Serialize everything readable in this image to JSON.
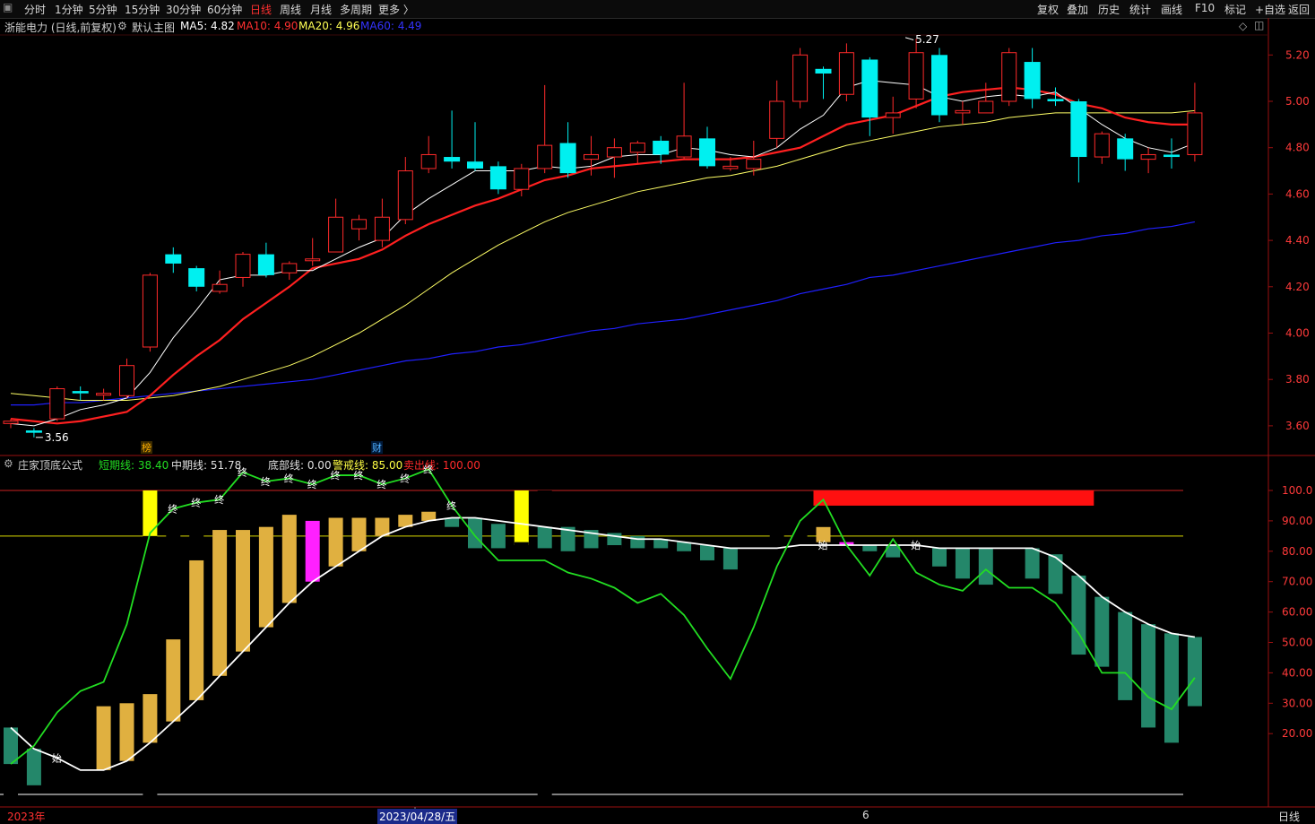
{
  "toolbar": {
    "left": [
      "分时",
      "1分钟",
      "5分钟",
      "15分钟",
      "30分钟",
      "60分钟",
      "日线",
      "周线",
      "月线",
      "多周期",
      "更多 〉"
    ],
    "active": "日线",
    "right": [
      "复权",
      "叠加",
      "历史",
      "统计",
      "画线",
      "F10",
      "标记",
      "+自选",
      "返回"
    ]
  },
  "main_header": {
    "title": "浙能电力 (日线,前复权)",
    "template": "默认主图",
    "ma5": "MA5: 4.82",
    "ma10": "MA10: 4.90",
    "ma20": "MA20: 4.96",
    "ma60": "MA60: 4.49"
  },
  "indicator_header": {
    "name": "庄家顶底公式",
    "short": "短期线: 38.40",
    "mid": "中期线: 51.78",
    "bottom": "底部线: 0.00",
    "warn": "警戒线: 85.00",
    "sell": "卖出线: 100.00"
  },
  "bottom": {
    "year": "2023年",
    "date": "2023/04/28/五",
    "month": "6",
    "period": "日线"
  },
  "colors": {
    "up": "#ff2a2a",
    "down": "#00f0f0",
    "ma5": "#ffffff",
    "ma10": "#ff2020",
    "ma20": "#ffff66",
    "ma60": "#2020ff",
    "short": "#22dd22",
    "mid": "#ffffff",
    "gold": "#e0b040",
    "teal": "#24876a",
    "magenta": "#ff20ff",
    "yellow": "#ffff00"
  },
  "chart_data": {
    "type": "candlestick",
    "price_axis": {
      "ticks": [
        "5.20",
        "5.00",
        "4.80",
        "4.60",
        "4.40",
        "4.20",
        "4.00",
        "3.80",
        "3.60"
      ]
    },
    "marks": {
      "high": "5.27",
      "low": "3.56",
      "bang": "榜",
      "cai": "财"
    },
    "candles": [
      [
        3.61,
        3.62,
        3.59,
        3.63
      ],
      [
        3.58,
        3.57,
        3.55,
        3.59
      ],
      [
        3.63,
        3.76,
        3.62,
        3.77
      ],
      [
        3.75,
        3.74,
        3.71,
        3.77
      ],
      [
        3.74,
        3.74,
        3.71,
        3.76
      ],
      [
        3.73,
        3.86,
        3.72,
        3.89
      ],
      [
        3.94,
        4.25,
        3.92,
        4.26
      ],
      [
        4.34,
        4.3,
        4.26,
        4.37
      ],
      [
        4.28,
        4.2,
        4.18,
        4.29
      ],
      [
        4.18,
        4.21,
        4.17,
        4.27
      ],
      [
        4.24,
        4.34,
        4.2,
        4.35
      ],
      [
        4.34,
        4.25,
        4.24,
        4.39
      ],
      [
        4.26,
        4.3,
        4.23,
        4.31
      ],
      [
        4.32,
        4.32,
        4.29,
        4.41
      ],
      [
        4.35,
        4.5,
        4.35,
        4.58
      ],
      [
        4.45,
        4.49,
        4.4,
        4.51
      ],
      [
        4.4,
        4.5,
        4.37,
        4.58
      ],
      [
        4.49,
        4.7,
        4.47,
        4.76
      ],
      [
        4.71,
        4.77,
        4.69,
        4.85
      ],
      [
        4.76,
        4.74,
        4.71,
        4.96
      ],
      [
        4.74,
        4.71,
        4.7,
        4.91
      ],
      [
        4.72,
        4.62,
        4.6,
        4.74
      ],
      [
        4.62,
        4.71,
        4.59,
        4.73
      ],
      [
        4.71,
        4.81,
        4.69,
        5.07
      ],
      [
        4.82,
        4.69,
        4.67,
        4.91
      ],
      [
        4.75,
        4.77,
        4.68,
        4.85
      ],
      [
        4.76,
        4.8,
        4.67,
        4.84
      ],
      [
        4.78,
        4.82,
        4.73,
        4.83
      ],
      [
        4.83,
        4.77,
        4.73,
        4.85
      ],
      [
        4.76,
        4.85,
        4.75,
        5.08
      ],
      [
        4.84,
        4.72,
        4.71,
        4.89
      ],
      [
        4.71,
        4.72,
        4.7,
        4.76
      ],
      [
        4.71,
        4.75,
        4.68,
        4.83
      ],
      [
        4.84,
        5.0,
        4.8,
        5.09
      ],
      [
        5.0,
        5.2,
        4.97,
        5.23
      ],
      [
        5.14,
        5.12,
        5.01,
        5.15
      ],
      [
        5.03,
        5.21,
        5.0,
        5.25
      ],
      [
        5.18,
        4.93,
        4.85,
        5.19
      ],
      [
        4.93,
        4.95,
        4.86,
        5.02
      ],
      [
        5.01,
        5.21,
        4.97,
        5.27
      ],
      [
        5.2,
        4.94,
        4.91,
        5.23
      ],
      [
        4.95,
        4.96,
        4.9,
        5.0
      ],
      [
        4.95,
        5.0,
        4.96,
        5.08
      ],
      [
        5.0,
        5.21,
        4.98,
        5.23
      ],
      [
        5.17,
        5.01,
        4.97,
        5.23
      ],
      [
        5.01,
        5.0,
        4.98,
        5.06
      ],
      [
        5.0,
        4.76,
        4.65,
        5.01
      ],
      [
        4.76,
        4.86,
        4.73,
        4.87
      ],
      [
        4.84,
        4.75,
        4.7,
        4.86
      ],
      [
        4.75,
        4.77,
        4.69,
        4.8
      ],
      [
        4.77,
        4.76,
        4.71,
        4.84
      ],
      [
        4.77,
        4.95,
        4.74,
        5.08
      ]
    ],
    "ma5": [
      3.61,
      3.6,
      3.63,
      3.67,
      3.69,
      3.72,
      3.83,
      3.98,
      4.1,
      4.23,
      4.25,
      4.25,
      4.27,
      4.27,
      4.32,
      4.37,
      4.41,
      4.51,
      4.58,
      4.64,
      4.7,
      4.7,
      4.7,
      4.72,
      4.71,
      4.72,
      4.76,
      4.77,
      4.77,
      4.8,
      4.79,
      4.77,
      4.76,
      4.8,
      4.88,
      4.94,
      5.06,
      5.09,
      5.08,
      5.07,
      5.02,
      5.0,
      5.02,
      5.03,
      5.02,
      5.04,
      4.97,
      4.9,
      4.84,
      4.8,
      4.78,
      4.82
    ],
    "ma10": [
      3.63,
      3.62,
      3.61,
      3.62,
      3.64,
      3.66,
      3.73,
      3.82,
      3.9,
      3.97,
      4.06,
      4.13,
      4.2,
      4.28,
      4.3,
      4.32,
      4.36,
      4.42,
      4.47,
      4.51,
      4.55,
      4.58,
      4.62,
      4.66,
      4.68,
      4.71,
      4.72,
      4.73,
      4.74,
      4.75,
      4.75,
      4.75,
      4.76,
      4.78,
      4.8,
      4.85,
      4.9,
      4.92,
      4.94,
      4.98,
      5.02,
      5.04,
      5.05,
      5.06,
      5.05,
      5.03,
      4.99,
      4.97,
      4.93,
      4.91,
      4.9,
      4.9
    ],
    "ma20": [
      3.74,
      3.73,
      3.72,
      3.71,
      3.71,
      3.71,
      3.72,
      3.73,
      3.75,
      3.77,
      3.8,
      3.83,
      3.86,
      3.9,
      3.95,
      4.0,
      4.06,
      4.12,
      4.19,
      4.26,
      4.32,
      4.38,
      4.43,
      4.48,
      4.52,
      4.55,
      4.58,
      4.61,
      4.63,
      4.65,
      4.67,
      4.68,
      4.7,
      4.72,
      4.75,
      4.78,
      4.81,
      4.83,
      4.85,
      4.87,
      4.89,
      4.9,
      4.91,
      4.93,
      4.94,
      4.95,
      4.95,
      4.95,
      4.95,
      4.95,
      4.95,
      4.96
    ],
    "ma60": [
      3.69,
      3.69,
      3.7,
      3.7,
      3.71,
      3.72,
      3.73,
      3.74,
      3.75,
      3.76,
      3.77,
      3.78,
      3.79,
      3.8,
      3.82,
      3.84,
      3.86,
      3.88,
      3.89,
      3.91,
      3.92,
      3.94,
      3.95,
      3.97,
      3.99,
      4.01,
      4.02,
      4.04,
      4.05,
      4.06,
      4.08,
      4.1,
      4.12,
      4.14,
      4.17,
      4.19,
      4.21,
      4.24,
      4.25,
      4.27,
      4.29,
      4.31,
      4.33,
      4.35,
      4.37,
      4.39,
      4.4,
      4.42,
      4.43,
      4.45,
      4.46,
      4.48
    ],
    "indicator": {
      "axis_ticks": [
        "100.0",
        "90.00",
        "80.00",
        "70.00",
        "60.00",
        "50.00",
        "40.00",
        "30.00",
        "20.00"
      ],
      "short_line": [
        10,
        16,
        27,
        34,
        37,
        56,
        86,
        94,
        96,
        97,
        106,
        103,
        104,
        102,
        105,
        105,
        102,
        104,
        107,
        95,
        85,
        77,
        77,
        77,
        73,
        71,
        68,
        63,
        66,
        59,
        48,
        38,
        55,
        75,
        90,
        97,
        82,
        72,
        84,
        73,
        69,
        67,
        74,
        68,
        68,
        63,
        53,
        40,
        40,
        32,
        28,
        38.4
      ],
      "mid_line": [
        22,
        15,
        12,
        8,
        8,
        11,
        17,
        24,
        31,
        39,
        47,
        55,
        63,
        70,
        75,
        80,
        85,
        88,
        90,
        91,
        91,
        90,
        89,
        88,
        87,
        86,
        85,
        84,
        84,
        83,
        82,
        81,
        81,
        81,
        82,
        82,
        82,
        82,
        82,
        82,
        81,
        81,
        81,
        81,
        81,
        78,
        72,
        65,
        60,
        56,
        53,
        51.78
      ],
      "bars": [
        [
          [
            "teal",
            22,
            10
          ],
          [
            "red",
            5,
            -2
          ]
        ],
        [
          [
            "teal",
            15,
            3
          ]
        ],
        [
          [
            "red",
            30,
            3
          ]
        ],
        [
          [
            "red",
            37,
            3
          ]
        ],
        [
          [
            "red",
            38,
            8
          ],
          [
            "gold",
            29,
            8
          ]
        ],
        [
          [
            "red",
            56,
            11
          ],
          [
            "gold",
            30,
            11
          ]
        ],
        [
          [
            "yellow",
            100,
            85
          ],
          [
            "red",
            85,
            -2
          ],
          [
            "gold",
            33,
            17
          ]
        ],
        [
          [
            "red",
            87,
            24
          ],
          [
            "gold",
            51,
            24
          ]
        ],
        [
          [
            "red",
            86,
            31
          ],
          [
            "gold",
            77,
            31
          ]
        ],
        [
          [
            "red",
            88,
            39
          ],
          [
            "gold",
            87,
            39
          ]
        ],
        [
          [
            "red",
            95,
            47
          ],
          [
            "gold",
            87,
            47
          ]
        ],
        [
          [
            "red",
            93,
            55
          ],
          [
            "gold",
            88,
            55
          ]
        ],
        [
          [
            "red",
            93,
            63
          ],
          [
            "gold",
            92,
            63
          ]
        ],
        [
          [
            "magenta",
            90,
            70
          ]
        ],
        [
          [
            "red",
            93,
            75
          ],
          [
            "gold",
            91,
            75
          ]
        ],
        [
          [
            "red",
            93,
            80
          ],
          [
            "gold",
            91,
            80
          ]
        ],
        [
          [
            "red",
            93,
            85
          ],
          [
            "gold",
            91,
            85
          ]
        ],
        [
          [
            "red",
            94,
            88
          ],
          [
            "gold",
            92,
            88
          ]
        ],
        [
          [
            "red",
            95,
            90
          ],
          [
            "gold",
            93,
            90
          ]
        ],
        [
          [
            "teal",
            91,
            88
          ]
        ],
        [
          [
            "teal",
            91,
            81
          ]
        ],
        [
          [
            "teal",
            89,
            81
          ]
        ],
        [
          [
            "yellow",
            100,
            82
          ],
          [
            "red",
            83,
            81
          ]
        ],
        [
          [
            "red",
            100,
            -2
          ],
          [
            "teal",
            88,
            81
          ]
        ],
        [
          [
            "teal",
            88,
            80
          ]
        ],
        [
          [
            "teal",
            87,
            81
          ]
        ],
        [
          [
            "teal",
            86,
            81
          ],
          [
            "red",
            82,
            80
          ]
        ],
        [
          [
            "teal",
            85,
            81
          ]
        ],
        [
          [
            "teal",
            84,
            81
          ]
        ],
        [
          [
            "teal",
            83,
            80
          ]
        ],
        [
          [
            "teal",
            82,
            77
          ]
        ],
        [
          [
            "teal",
            81,
            74
          ]
        ],
        [
          [
            "red",
            81,
            74
          ]
        ],
        [
          [
            "red",
            87,
            74
          ]
        ],
        [
          [
            "red",
            88,
            81
          ]
        ],
        [
          [
            "gold",
            88,
            83
          ],
          [
            "red",
            92,
            88
          ]
        ],
        [
          [
            "magenta",
            83,
            82
          ]
        ],
        [
          [
            "teal",
            82,
            80
          ]
        ],
        [
          [
            "teal",
            82,
            78
          ]
        ],
        [
          [
            "red",
            82,
            78
          ]
        ],
        [
          [
            "teal",
            81,
            75
          ]
        ],
        [
          [
            "teal",
            81,
            71
          ]
        ],
        [
          [
            "teal",
            81,
            69
          ]
        ],
        [
          [
            "red",
            81,
            71
          ]
        ],
        [
          [
            "teal",
            81,
            71
          ]
        ],
        [
          [
            "teal",
            79,
            66
          ]
        ],
        [
          [
            "teal",
            72,
            46
          ]
        ],
        [
          [
            "teal",
            65,
            42
          ]
        ],
        [
          [
            "teal",
            60,
            31
          ]
        ],
        [
          [
            "teal",
            56,
            22
          ]
        ],
        [
          [
            "teal",
            53,
            17
          ]
        ],
        [
          [
            "teal",
            51.78,
            29
          ],
          [
            "red",
            29,
            17
          ]
        ]
      ],
      "sell_zone": [
        100,
        95
      ],
      "labels": {
        "start": "始",
        "end": "终"
      },
      "end_positions": [
        7,
        8,
        9,
        10,
        11,
        12,
        13,
        14,
        15,
        16,
        17,
        18,
        19
      ],
      "start_positions": [
        2,
        35,
        39
      ]
    }
  }
}
